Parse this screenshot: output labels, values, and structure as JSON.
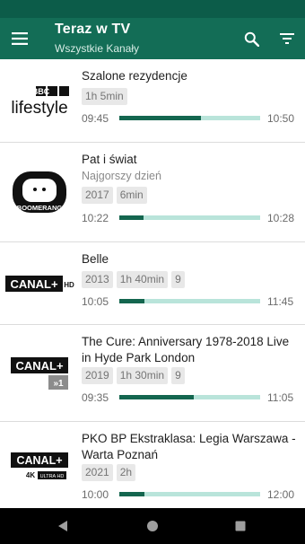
{
  "app": {
    "title": "Teraz w TV",
    "subtitle": "Wszystkie Kanały"
  },
  "icons": {
    "menu": "menu-icon",
    "search": "search-icon",
    "filter": "filter-icon",
    "back": "back-icon",
    "home": "home-icon",
    "recents": "recents-icon"
  },
  "colors": {
    "app_bar": "#136d56",
    "status_bar": "#0c5c49",
    "progress_fill": "#14664f",
    "progress_track": "#b9e4da"
  },
  "programs": [
    {
      "channel": "BBC Lifestyle",
      "logo_text": [
        "BBC",
        "lifestyle"
      ],
      "title": "Szalone rezydencje",
      "subtitle": "",
      "chips": [
        "1h 5min"
      ],
      "start": "09:45",
      "end": "10:50",
      "progress": 0.58
    },
    {
      "channel": "Boomerang",
      "logo_text": [
        "BOOMERANG"
      ],
      "title": "Pat i świat",
      "subtitle": "Najgorszy dzień",
      "chips": [
        "2017",
        "6min"
      ],
      "start": "10:22",
      "end": "10:28",
      "progress": 0.17
    },
    {
      "channel": "Canal+ HD",
      "logo_text": [
        "CANAL+",
        "HD"
      ],
      "title": "Belle",
      "subtitle": "",
      "chips": [
        "2013",
        "1h 40min",
        "9"
      ],
      "start": "10:05",
      "end": "11:45",
      "progress": 0.18
    },
    {
      "channel": "Canal+ 1",
      "logo_text": [
        "CANAL+",
        "»1"
      ],
      "title": "The Cure: Anniversary 1978-2018 Live in Hyde Park London",
      "subtitle": "",
      "chips": [
        "2019",
        "1h 30min",
        "9"
      ],
      "start": "09:35",
      "end": "11:05",
      "progress": 0.53
    },
    {
      "channel": "Canal+ 4K Ultra HD",
      "logo_text": [
        "CANAL+",
        "4K",
        "ULTRA HD"
      ],
      "title": "PKO BP Ekstraklasa: Legia Warszawa - Warta Poznań",
      "subtitle": "",
      "chips": [
        "2021",
        "2h"
      ],
      "start": "10:00",
      "end": "12:00",
      "progress": 0.18
    }
  ]
}
